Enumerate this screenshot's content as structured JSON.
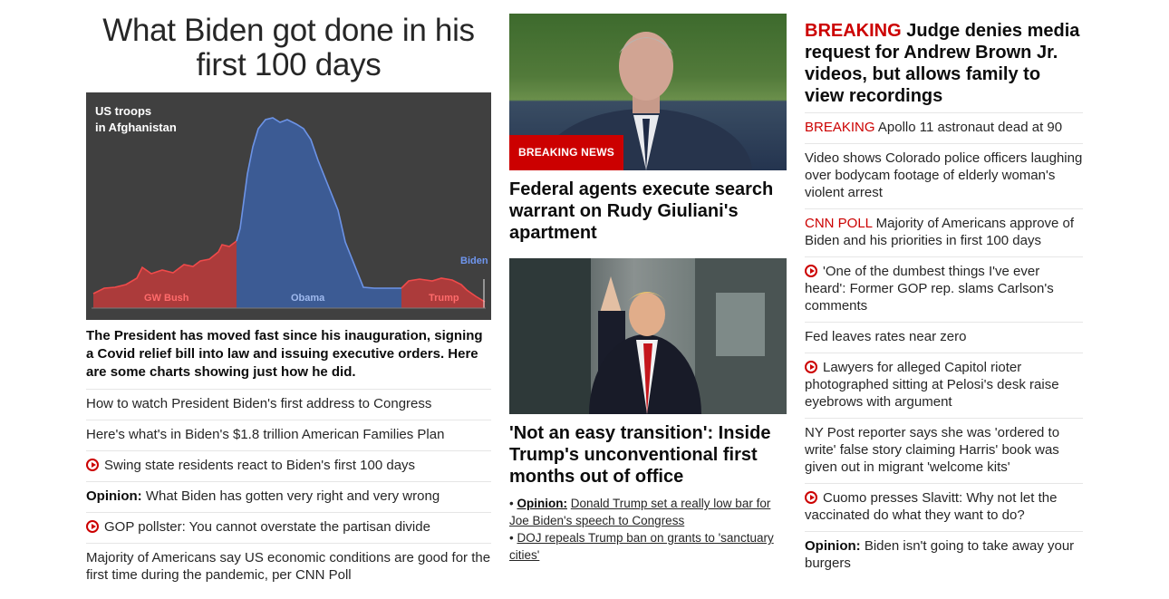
{
  "left": {
    "hero_title": "What Biden got done in his first 100 days",
    "chart_caption": "The President has moved fast since his inauguration, signing a Covid relief bill into law and issuing executive orders. Here are some charts showing just how he did.",
    "links": [
      {
        "text": "How to watch President Biden's first address to Congress"
      },
      {
        "text": "Here's what's in Biden's $1.8 trillion American Families Plan"
      },
      {
        "text": "Swing state residents react to Biden's first 100 days",
        "icon": "play-icon"
      },
      {
        "kicker": "Opinion:",
        "text": "What Biden has gotten very right and very wrong"
      },
      {
        "text": "GOP pollster: You cannot overstate the partisan divide",
        "icon": "play-icon"
      },
      {
        "text": "Majority of Americans say US economic conditions are good for the first time during the pandemic, per CNN Poll"
      }
    ]
  },
  "chart_data": {
    "type": "area",
    "title": "US troops in Afghanistan",
    "series": [
      {
        "name": "GW Bush",
        "color": "#d03a3a"
      },
      {
        "name": "Obama",
        "color": "#3b64b0"
      },
      {
        "name": "Trump",
        "color": "#d03a3a"
      },
      {
        "name": "Biden",
        "color": "#4d78d0"
      }
    ],
    "grid": false,
    "background": "#404040"
  },
  "middle": {
    "story1": {
      "badge": "BREAKING NEWS",
      "headline": "Federal agents execute search warrant on Rudy Giuliani's apartment"
    },
    "story2": {
      "headline": "'Not an easy transition': Inside Trump's unconventional first months out of office",
      "sub": [
        {
          "kicker": "Opinion:",
          "text": "Donald Trump set a really low bar for Joe Biden's speech to Congress"
        },
        {
          "text": "DOJ repeals Trump ban on grants to 'sanctuary cities'"
        }
      ]
    }
  },
  "right": {
    "headline_kicker": "BREAKING",
    "headline": "Judge denies media request for Andrew Brown Jr. videos, but allows family to view recordings",
    "links": [
      {
        "red_kicker": "BREAKING",
        "text": "Apollo 11 astronaut dead at 90"
      },
      {
        "text": "Video shows Colorado police officers laughing over bodycam footage of elderly woman's violent arrest"
      },
      {
        "red_kicker": "CNN POLL",
        "text": "Majority of Americans approve of Biden and his priorities in first 100 days"
      },
      {
        "text": "'One of the dumbest things I've ever heard': Former GOP rep. slams Carlson's comments",
        "icon": "play-icon"
      },
      {
        "text": "Fed leaves rates near zero"
      },
      {
        "text": "Lawyers for alleged Capitol rioter photographed sitting at Pelosi's desk raise eyebrows with argument",
        "icon": "play-icon"
      },
      {
        "text": "NY Post reporter says she was 'ordered to write' false story claiming Harris' book was given out in migrant 'welcome kits'"
      },
      {
        "text": "Cuomo presses Slavitt: Why not let the vaccinated do what they want to do?",
        "icon": "play-icon"
      },
      {
        "kicker": "Opinion:",
        "text": "Biden isn't going to take away your burgers"
      }
    ]
  },
  "colors": {
    "accent": "#cc0000",
    "text": "#262626",
    "divider": "#e6e6e6"
  }
}
